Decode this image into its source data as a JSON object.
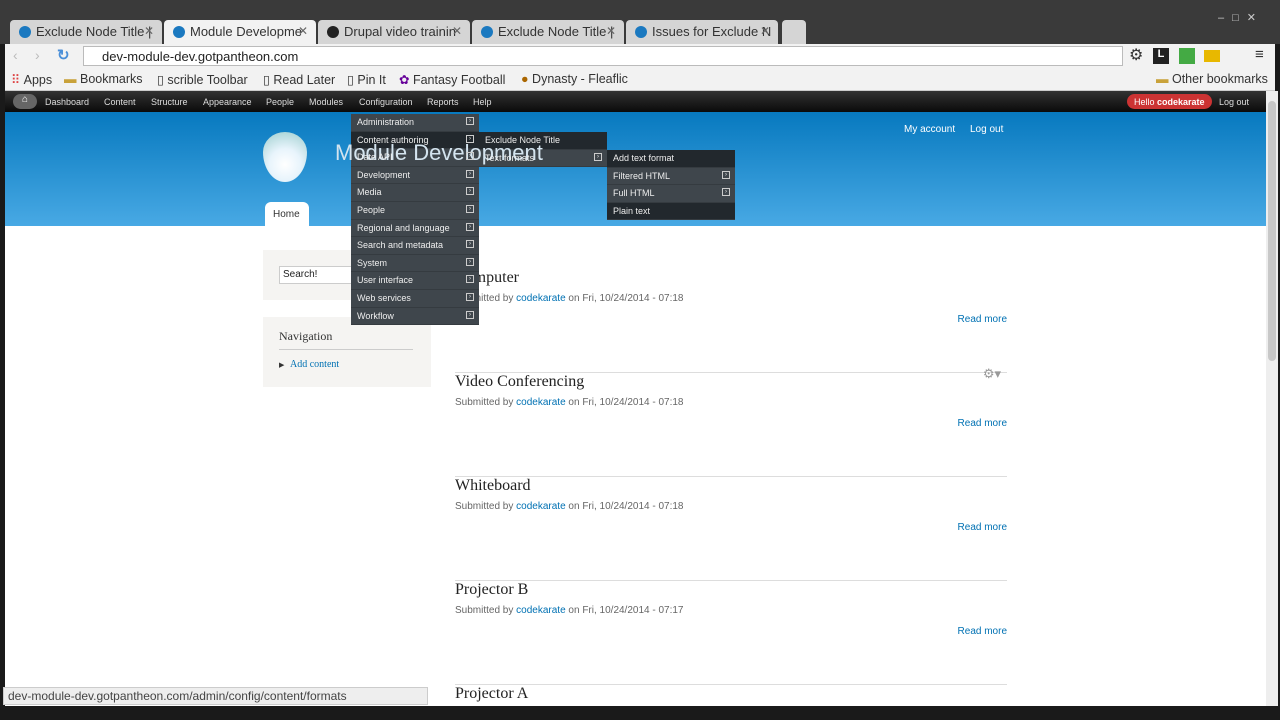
{
  "browser": {
    "tabs": [
      "Exclude Node Title |",
      "Module Developme",
      "Drupal video trainin",
      "Exclude Node Title |",
      "Issues for Exclude N"
    ],
    "url": "dev-module-dev.gotpantheon.com",
    "bookmarks": [
      "Apps",
      "Bookmarks",
      "scrible Toolbar",
      "Read Later",
      "Pin It",
      "Fantasy Football",
      "Dynasty - Fleaflic"
    ],
    "other_bookmarks": "Other bookmarks",
    "status": "dev-module-dev.gotpantheon.com/admin/config/content/formats"
  },
  "toolbar": {
    "items": [
      "Dashboard",
      "Content",
      "Structure",
      "Appearance",
      "People",
      "Modules",
      "Configuration",
      "Reports",
      "Help"
    ],
    "hello": "Hello ",
    "user": "codekarate",
    "logout": "Log out"
  },
  "header": {
    "site_name": "Module Development",
    "my_account": "My account",
    "logout": "Log out",
    "home_tab": "Home"
  },
  "config_menu": [
    "Administration",
    "Content authoring",
    "Date API",
    "Development",
    "Media",
    "People",
    "Regional and language",
    "Search and metadata",
    "System",
    "User interface",
    "Web services",
    "Workflow"
  ],
  "content_authoring_menu": [
    "Exclude Node Title",
    "Text formats"
  ],
  "text_formats_menu": [
    "Add text format",
    "Filtered HTML",
    "Full HTML",
    "Plain text"
  ],
  "sidebar": {
    "search_placeholder": "Search!",
    "nav_title": "Navigation",
    "add_content": "Add content"
  },
  "nodes": [
    {
      "title": "Computer",
      "by": "Submitted by ",
      "author": "codekarate",
      "date": " on Fri, 10/24/2014 - 07:18",
      "read_more": "Read more"
    },
    {
      "title": "Video Conferencing",
      "by": "Submitted by ",
      "author": "codekarate",
      "date": " on Fri, 10/24/2014 - 07:18",
      "read_more": "Read more"
    },
    {
      "title": "Whiteboard",
      "by": "Submitted by ",
      "author": "codekarate",
      "date": " on Fri, 10/24/2014 - 07:18",
      "read_more": "Read more"
    },
    {
      "title": "Projector B",
      "by": "Submitted by ",
      "author": "codekarate",
      "date": " on Fri, 10/24/2014 - 07:17",
      "read_more": "Read more"
    },
    {
      "title": "Projector A"
    }
  ]
}
